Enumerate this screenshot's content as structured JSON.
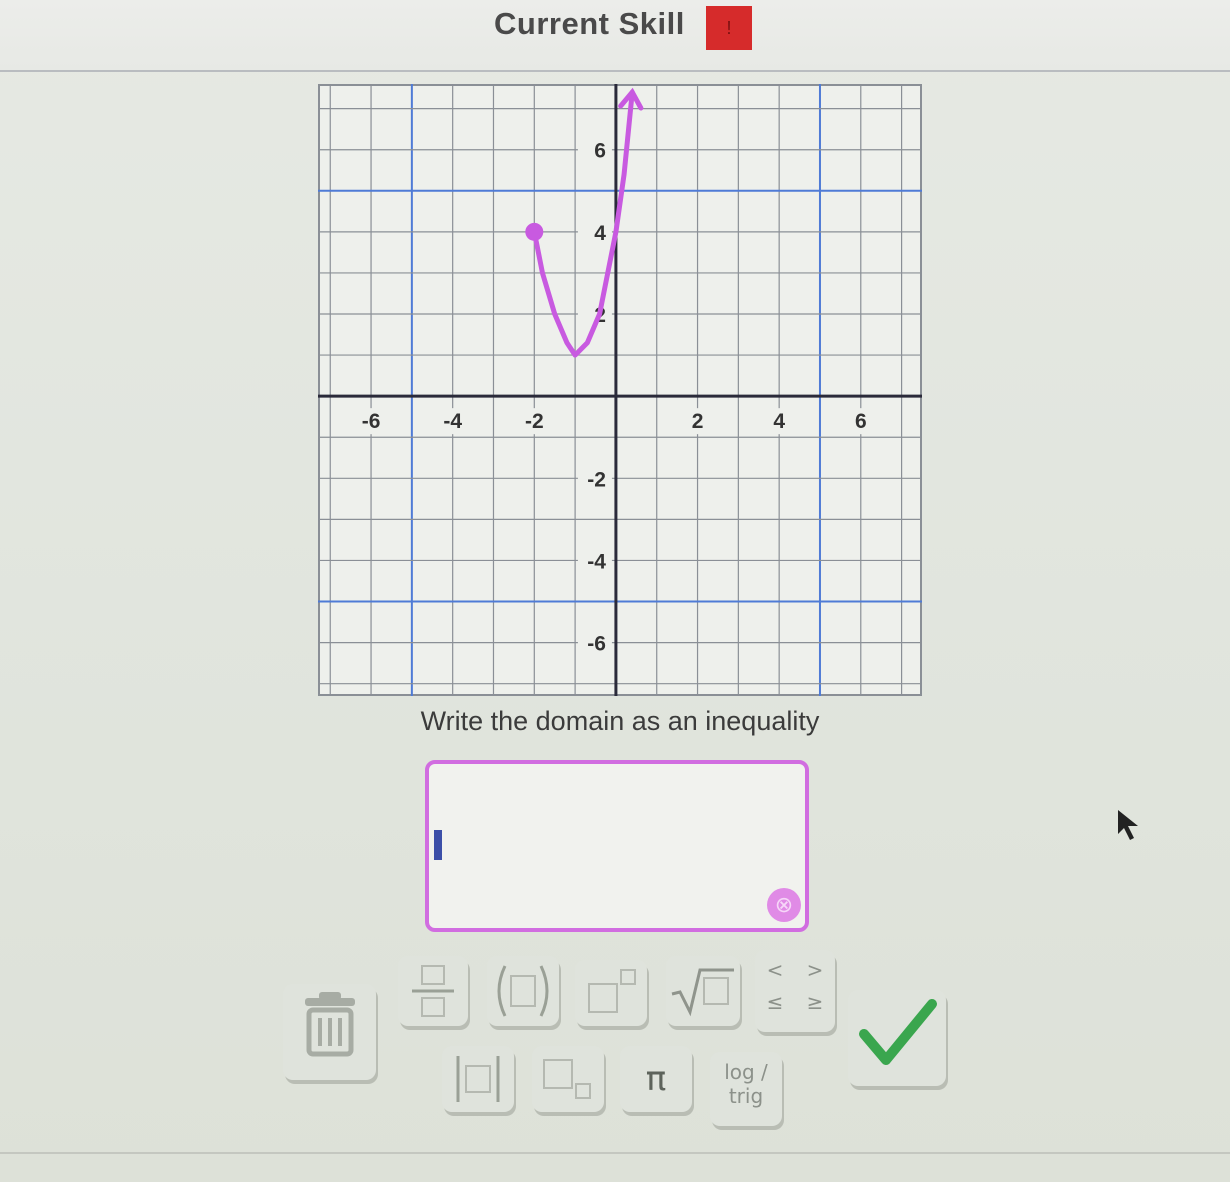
{
  "header": {
    "title": "Current Skill",
    "badge": "!"
  },
  "question": {
    "prompt": "Write the domain as an inequality"
  },
  "answer": {
    "value": ""
  },
  "keypad": {
    "trash": "trash-icon",
    "fraction": "fraction-icon",
    "parentheses": "parentheses-icon",
    "exponent": "exponent-icon",
    "sqrt": "sqrt-icon",
    "inequalities": [
      "<",
      ">",
      "≤",
      "≥"
    ],
    "absolute_value": "absolute-value-icon",
    "subscript": "subscript-icon",
    "pi": "π",
    "log_trig": [
      "log /",
      "trig"
    ],
    "submit": "checkmark-icon"
  },
  "colors": {
    "curve": "#c85ae0",
    "grid_major": "#4f7bd6",
    "grid_minor": "#8a8f96",
    "axis": "#2a2a3a",
    "badge": "#d62b2b",
    "submit_check": "#3aa64e",
    "answer_border": "#d16de0"
  },
  "chart_data": {
    "type": "line",
    "xlim": [
      -7.3,
      7.5
    ],
    "ylim": [
      -7.3,
      7.6
    ],
    "x_ticks": [
      "-6",
      "-4",
      "-2",
      "2",
      "4",
      "6"
    ],
    "y_ticks": [
      "6",
      "4",
      "2",
      "-2",
      "-4",
      "-6"
    ],
    "x_tick_values": [
      -6,
      -4,
      -2,
      2,
      4,
      6
    ],
    "y_tick_values": [
      6,
      4,
      2,
      -2,
      -4,
      -6
    ],
    "grid": true,
    "series": [
      {
        "x": [
          -2,
          -1.8,
          -1.5,
          -1.2,
          -1,
          -0.7,
          -0.4,
          -0.2,
          0,
          0.2,
          0.4
        ],
        "y": [
          4,
          3,
          2,
          1.3,
          1,
          1.3,
          2,
          3,
          4,
          5.4,
          7.4
        ],
        "start_point": "closed",
        "end": "arrow"
      }
    ]
  }
}
